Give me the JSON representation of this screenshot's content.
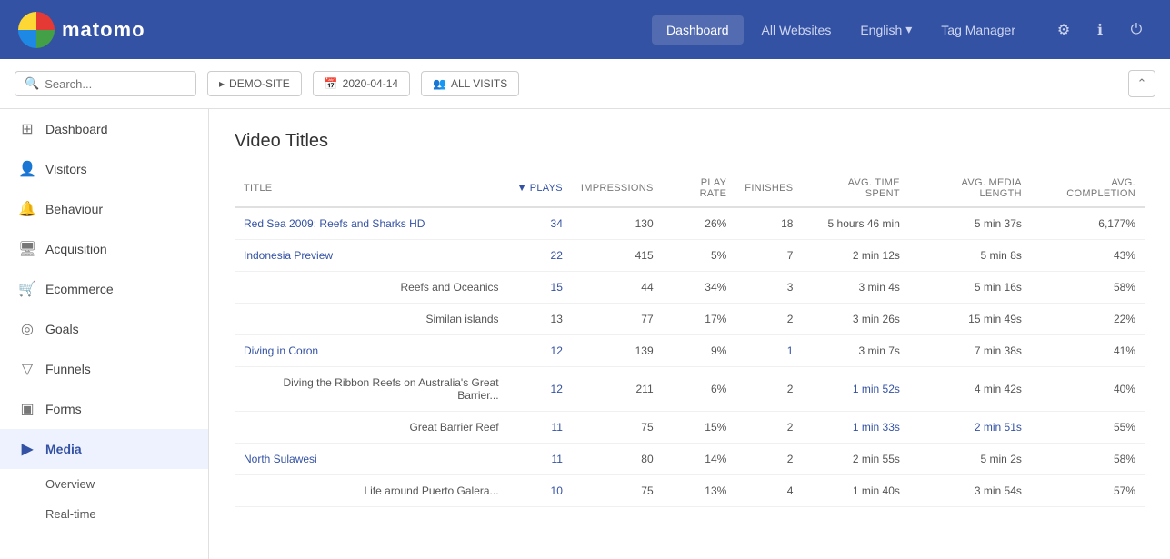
{
  "topnav": {
    "logo_text": "matomo",
    "links": [
      {
        "label": "Dashboard",
        "active": true
      },
      {
        "label": "All Websites",
        "active": false
      }
    ],
    "language": "English",
    "language_dropdown_arrow": "▾",
    "tag_manager": "Tag Manager",
    "icons": [
      {
        "name": "settings-icon",
        "glyph": "⚙"
      },
      {
        "name": "help-icon",
        "glyph": "ℹ"
      },
      {
        "name": "logout-icon",
        "glyph": "⏻"
      }
    ]
  },
  "toolbar": {
    "search_placeholder": "Search...",
    "demo_site_label": "DEMO-SITE",
    "date_label": "2020-04-14",
    "visits_label": "ALL VISITS",
    "calendar_icon": "📅",
    "people_icon": "👥",
    "caret_icon": "▸",
    "collapse_icon": "⌃"
  },
  "sidebar": {
    "items": [
      {
        "label": "Dashboard",
        "icon": "⊞",
        "active": false
      },
      {
        "label": "Visitors",
        "icon": "👤",
        "active": false
      },
      {
        "label": "Behaviour",
        "icon": "🔔",
        "active": false
      },
      {
        "label": "Acquisition",
        "icon": "🖥",
        "active": false
      },
      {
        "label": "Ecommerce",
        "icon": "🛒",
        "active": false
      },
      {
        "label": "Goals",
        "icon": "◎",
        "active": false
      },
      {
        "label": "Funnels",
        "icon": "▽",
        "active": false
      },
      {
        "label": "Forms",
        "icon": "▣",
        "active": false
      },
      {
        "label": "Media",
        "icon": "▶",
        "active": true
      }
    ],
    "sub_items": [
      {
        "label": "Overview"
      },
      {
        "label": "Real-time"
      }
    ]
  },
  "content": {
    "page_title": "Video Titles",
    "table": {
      "columns": [
        {
          "key": "title",
          "label": "TITLE",
          "align": "left",
          "sorted": false
        },
        {
          "key": "plays",
          "label": "PLAYS",
          "align": "right",
          "sorted": true
        },
        {
          "key": "impressions",
          "label": "IMPRESSIONS",
          "align": "right",
          "sorted": false
        },
        {
          "key": "play_rate",
          "label": "PLAY RATE",
          "align": "right",
          "sorted": false
        },
        {
          "key": "finishes",
          "label": "FINISHES",
          "align": "right",
          "sorted": false
        },
        {
          "key": "avg_time_spent",
          "label": "AVG. TIME SPENT",
          "align": "right",
          "sorted": false
        },
        {
          "key": "avg_media_length",
          "label": "AVG. MEDIA LENGTH",
          "align": "right",
          "sorted": false
        },
        {
          "key": "avg_completion",
          "label": "AVG. COMPLETION",
          "align": "right",
          "sorted": false
        }
      ],
      "rows": [
        {
          "title": "Red Sea 2009: Reefs and Sharks HD",
          "plays": "34",
          "impressions": "130",
          "play_rate": "26%",
          "finishes": "18",
          "avg_time_spent": "5 hours 46 min",
          "avg_media_length": "5 min 37s",
          "avg_completion": "6,177%",
          "title_link": true,
          "plays_link": true,
          "impressions_link": false,
          "finishes_link": false,
          "avg_time_link": false,
          "avg_media_link": false
        },
        {
          "title": "Indonesia Preview",
          "plays": "22",
          "impressions": "415",
          "play_rate": "5%",
          "finishes": "7",
          "avg_time_spent": "2 min 12s",
          "avg_media_length": "5 min 8s",
          "avg_completion": "43%",
          "title_link": true,
          "plays_link": true
        },
        {
          "title": "Reefs and Oceanics",
          "plays": "15",
          "impressions": "44",
          "play_rate": "34%",
          "finishes": "3",
          "avg_time_spent": "3 min 4s",
          "avg_media_length": "5 min 16s",
          "avg_completion": "58%",
          "title_link": false,
          "plays_link": true
        },
        {
          "title": "Similan islands",
          "plays": "13",
          "impressions": "77",
          "play_rate": "17%",
          "finishes": "2",
          "avg_time_spent": "3 min 26s",
          "avg_media_length": "15 min 49s",
          "avg_completion": "22%",
          "title_link": false,
          "plays_link": false
        },
        {
          "title": "Diving in Coron",
          "plays": "12",
          "impressions": "139",
          "play_rate": "9%",
          "finishes": "1",
          "avg_time_spent": "3 min 7s",
          "avg_media_length": "7 min 38s",
          "avg_completion": "41%",
          "title_link": true,
          "plays_link": true,
          "finishes_link": true
        },
        {
          "title": "Diving the Ribbon Reefs on Australia's Great Barrier...",
          "plays": "12",
          "impressions": "211",
          "play_rate": "6%",
          "finishes": "2",
          "avg_time_spent": "1 min 52s",
          "avg_media_length": "4 min 42s",
          "avg_completion": "40%",
          "title_link": false,
          "plays_link": true,
          "avg_time_link": true
        },
        {
          "title": "Great Barrier Reef",
          "plays": "11",
          "impressions": "75",
          "play_rate": "15%",
          "finishes": "2",
          "avg_time_spent": "1 min 33s",
          "avg_media_length": "2 min 51s",
          "avg_completion": "55%",
          "title_link": false,
          "plays_link": true,
          "avg_time_link": true,
          "avg_media_link": true
        },
        {
          "title": "North Sulawesi",
          "plays": "11",
          "impressions": "80",
          "play_rate": "14%",
          "finishes": "2",
          "avg_time_spent": "2 min 55s",
          "avg_media_length": "5 min 2s",
          "avg_completion": "58%",
          "title_link": true,
          "plays_link": true
        },
        {
          "title": "Life around Puerto Galera...",
          "plays": "10",
          "impressions": "75",
          "play_rate": "13%",
          "finishes": "4",
          "avg_time_spent": "1 min 40s",
          "avg_media_length": "3 min 54s",
          "avg_completion": "57%",
          "title_link": false,
          "plays_link": true
        }
      ]
    }
  }
}
